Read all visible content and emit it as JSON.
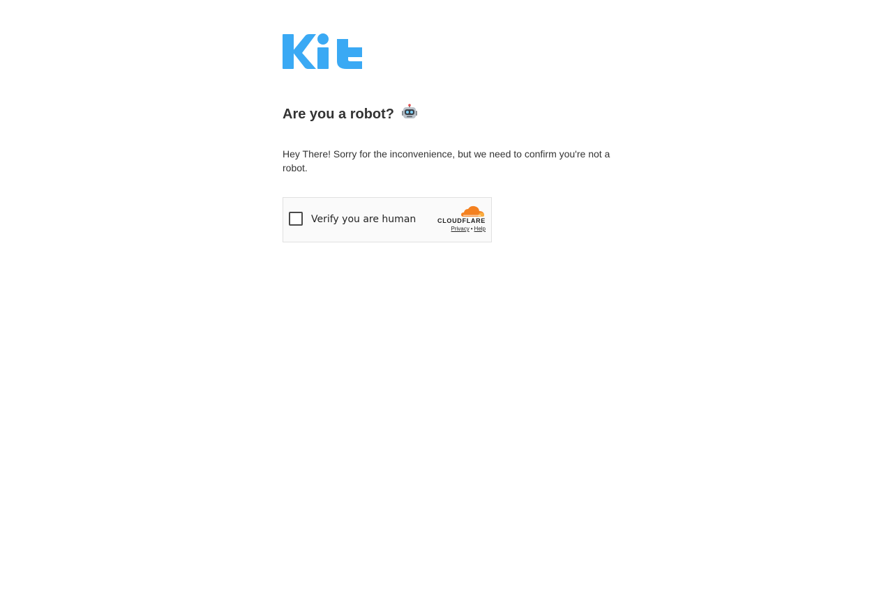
{
  "brand": {
    "logo_text": "Kit",
    "logo_color": "#3aa9f4"
  },
  "page": {
    "title": "Are you a robot?",
    "title_icon": "robot-icon",
    "message": "Hey There! Sorry for the inconvenience, but we need to confirm you're not a robot."
  },
  "captcha": {
    "label": "Verify you are human",
    "checked": false,
    "provider": "CLOUDFLARE",
    "provider_icon": "cloudflare-cloud-icon",
    "provider_colors": [
      "#f48120",
      "#faad3f"
    ],
    "privacy_link": "Privacy",
    "separator": "•",
    "help_link": "Help"
  }
}
